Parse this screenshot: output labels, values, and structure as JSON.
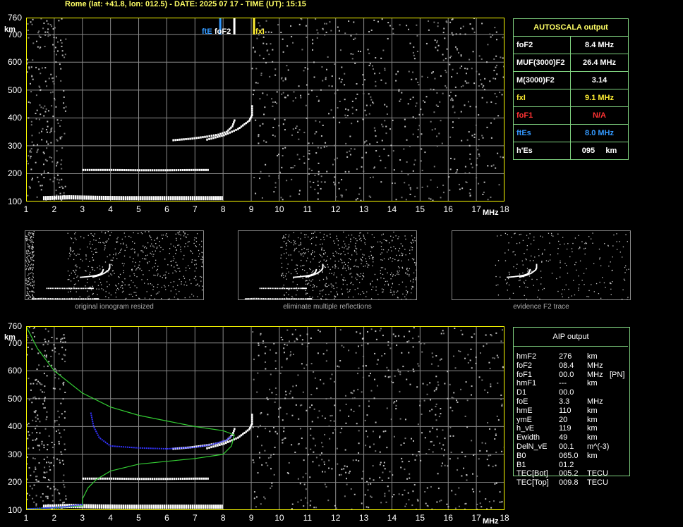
{
  "title": "Rome (lat: +41.8, lon: 012.5) - DATE: 2025 07 17 - TIME (UT): 15:15",
  "colors": {
    "axis": "#ffff00",
    "grid": "#8a8a8a",
    "panel_border": "#7fd17f",
    "fte": "#3399ff",
    "fof2": "#ffffff",
    "fxi": "#ffee33",
    "fof1": "#ff3333",
    "profile": "#33cc33",
    "trace_blue": "#3333ff"
  },
  "axes": {
    "y_unit": "km",
    "x_unit": "MHz",
    "y_ticks": [
      "760",
      "700",
      "600",
      "500",
      "400",
      "300",
      "200",
      "100"
    ],
    "x_ticks": [
      "1",
      "2",
      "3",
      "4",
      "5",
      "6",
      "7",
      "8",
      "9",
      "10",
      "11",
      "12",
      "13",
      "14",
      "15",
      "16",
      "17",
      "18"
    ]
  },
  "marker_labels": {
    "fte": "ftE",
    "fof2": "foF2",
    "fxi": "fxI"
  },
  "chart_data": [
    {
      "type": "scatter",
      "name": "ionogram",
      "xlim": [
        1,
        18
      ],
      "ylim": [
        100,
        760
      ],
      "xlabel": "MHz",
      "ylabel": "km",
      "grid": true,
      "markers": [
        {
          "label": "ftE",
          "x": 7.9
        },
        {
          "label": "foF2",
          "x": 8.4
        },
        {
          "label": "fxI",
          "x": 9.1
        }
      ],
      "traces": [
        {
          "kind": "E-layer",
          "points": [
            [
              1.6,
              112
            ],
            [
              2.5,
              115
            ],
            [
              3.5,
              113
            ],
            [
              4.5,
              112
            ],
            [
              5.5,
              112
            ],
            [
              6.5,
              112
            ],
            [
              7.5,
              112
            ],
            [
              8.0,
              112
            ]
          ]
        },
        {
          "kind": "E-second-hop",
          "points": [
            [
              3.0,
              213
            ],
            [
              4.0,
              213
            ],
            [
              5.0,
              212
            ],
            [
              6.0,
              212
            ],
            [
              7.0,
              213
            ],
            [
              7.5,
              213
            ]
          ]
        },
        {
          "kind": "F2-ordinary",
          "points": [
            [
              6.2,
              320
            ],
            [
              6.8,
              325
            ],
            [
              7.4,
              333
            ],
            [
              7.8,
              340
            ],
            [
              8.1,
              350
            ],
            [
              8.3,
              370
            ],
            [
              8.4,
              398
            ]
          ]
        },
        {
          "kind": "F2-extraordinary",
          "points": [
            [
              7.4,
              322
            ],
            [
              8.0,
              338
            ],
            [
              8.5,
              360
            ],
            [
              8.9,
              390
            ],
            [
              9.0,
              410
            ],
            [
              9.0,
              450
            ]
          ]
        }
      ]
    },
    {
      "type": "line",
      "name": "aip-profile",
      "xlim": [
        1,
        18
      ],
      "ylim": [
        100,
        760
      ],
      "xlabel": "MHz",
      "ylabel": "km",
      "grid": true,
      "series": [
        {
          "points": [
            [
              1.0,
              760
            ],
            [
              1.4,
              680
            ],
            [
              2.0,
              600
            ],
            [
              3.0,
              520
            ],
            [
              4.0,
              470
            ],
            [
              5.0,
              440
            ],
            [
              6.0,
              420
            ],
            [
              7.0,
              400
            ],
            [
              8.0,
              385
            ],
            [
              8.4,
              370
            ],
            [
              8.3,
              330
            ],
            [
              8.0,
              300
            ],
            [
              7.0,
              285
            ],
            [
              5.0,
              265
            ],
            [
              4.0,
              240
            ],
            [
              3.5,
              210
            ],
            [
              3.2,
              180
            ],
            [
              3.0,
              140
            ],
            [
              3.0,
              115
            ],
            [
              2.0,
              108
            ],
            [
              1.0,
              105
            ]
          ]
        },
        {
          "points": [
            [
              3.3,
              450
            ],
            [
              3.4,
              400
            ],
            [
              3.6,
              360
            ],
            [
              4.0,
              330
            ],
            [
              5.0,
              323
            ],
            [
              6.0,
              320
            ],
            [
              7.0,
              325
            ],
            [
              7.6,
              335
            ],
            [
              8.1,
              350
            ],
            [
              8.3,
              365
            ]
          ]
        },
        {
          "points": [
            [
              1.0,
              104
            ],
            [
              1.8,
              108
            ],
            [
              2.4,
              112
            ],
            [
              2.8,
              118
            ],
            [
              3.0,
              120
            ]
          ]
        }
      ]
    }
  ],
  "thumbnails": [
    {
      "caption": "original ionogram resized"
    },
    {
      "caption": "eliminate multiple reflections"
    },
    {
      "caption": "evidence F2 trace"
    }
  ],
  "autoscala": {
    "title": "AUTOSCALA output",
    "rows": [
      {
        "label": "foF2",
        "value": "8.4 MHz",
        "color": "#ffffff"
      },
      {
        "label": "MUF(3000)F2",
        "value": "26.4 MHz",
        "color": "#ffffff"
      },
      {
        "label": "M(3000)F2",
        "value": "3.14",
        "color": "#ffffff"
      },
      {
        "label": "fxI",
        "value": "9.1 MHz",
        "color": "#ffee33"
      },
      {
        "label": "foF1",
        "value": "N/A",
        "color": "#ff3333"
      },
      {
        "label": "ftEs",
        "value": "8.0 MHz",
        "color": "#3399ff"
      },
      {
        "label": "h'Es",
        "value": "095     km",
        "color": "#ffffff"
      }
    ]
  },
  "aip": {
    "title": "AIP output",
    "rows": [
      {
        "label": "hmF2",
        "value": "276",
        "unit": "km",
        "extra": ""
      },
      {
        "label": "foF2",
        "value": "08.4",
        "unit": "MHz",
        "extra": ""
      },
      {
        "label": "foF1",
        "value": "00.0",
        "unit": "MHz",
        "extra": "[PN]"
      },
      {
        "label": "hmF1",
        "value": "---",
        "unit": "km",
        "extra": ""
      },
      {
        "label": "D1",
        "value": "00.0",
        "unit": "",
        "extra": ""
      },
      {
        "label": "foE",
        "value": "3.3",
        "unit": "MHz",
        "extra": ""
      },
      {
        "label": "hmE",
        "value": "110",
        "unit": "km",
        "extra": ""
      },
      {
        "label": "ymE",
        "value": "20",
        "unit": "km",
        "extra": ""
      },
      {
        "label": "h_vE",
        "value": "119",
        "unit": "km",
        "extra": ""
      },
      {
        "label": "Ewidth",
        "value": "49",
        "unit": "km",
        "extra": ""
      },
      {
        "label": "DelN_vE",
        "value": "00.1",
        "unit": "m^(-3)",
        "extra": ""
      },
      {
        "label": "B0",
        "value": "065.0",
        "unit": "km",
        "extra": ""
      },
      {
        "label": "B1",
        "value": "01.2",
        "unit": "",
        "extra": ""
      },
      {
        "label": "TEC[Bot]",
        "value": "005.2",
        "unit": "TECU",
        "extra": ""
      },
      {
        "label": "TEC[Top]",
        "value": "009.8",
        "unit": "TECU",
        "extra": ""
      }
    ]
  }
}
